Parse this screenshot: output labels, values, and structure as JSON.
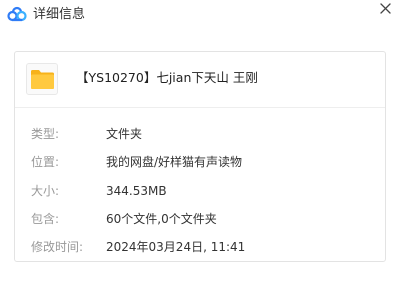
{
  "window": {
    "title": "详细信息",
    "app_icon": "cloud-icon",
    "close_icon": "close-icon",
    "accent_color": "#2f7cf6"
  },
  "file": {
    "name": "【YS10270】七jian下天山 王刚",
    "icon": "folder-icon",
    "icon_color": "#ffc53d"
  },
  "details": {
    "type_label": "类型:",
    "type_value": "文件夹",
    "location_label": "位置:",
    "location_value": "我的网盘/好样猫有声读物",
    "size_label": "大小:",
    "size_value": "344.53MB",
    "contains_label": "包含:",
    "contains_value": "60个文件,0个文件夹",
    "modified_label": "修改时间:",
    "modified_value": "2024年03月24日, 11:41"
  }
}
